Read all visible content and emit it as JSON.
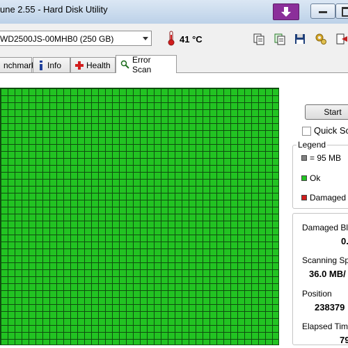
{
  "window": {
    "title": "une 2.55 - Hard Disk Utility"
  },
  "toolbar": {
    "disk_select": "WD2500JS-00MHB0 (250 GB)",
    "temperature": "41 °C"
  },
  "tabs": [
    {
      "label": "nchmark"
    },
    {
      "label": "Info"
    },
    {
      "label": "Health"
    },
    {
      "label": "Error Scan"
    }
  ],
  "scan": {
    "start_label": "Start",
    "quick_scan_label": "Quick Sca",
    "legend": {
      "title": "Legend",
      "items": [
        {
          "label": "= 95 MB",
          "color": "#808080"
        },
        {
          "label": "Ok",
          "color": "#22c322"
        },
        {
          "label": "Damaged",
          "color": "#d11d1d"
        }
      ]
    },
    "stats": [
      {
        "label": "Damaged Blo",
        "value": "0."
      },
      {
        "label": "Scanning Sp",
        "value": "36.0 MB/"
      },
      {
        "label": "Position",
        "value": "238379"
      },
      {
        "label": "Elapsed Time",
        "value": "79"
      }
    ]
  },
  "colors": {
    "ok_block": "#22c322",
    "grid_line": "#0f4e0f",
    "damaged": "#d11d1d"
  }
}
